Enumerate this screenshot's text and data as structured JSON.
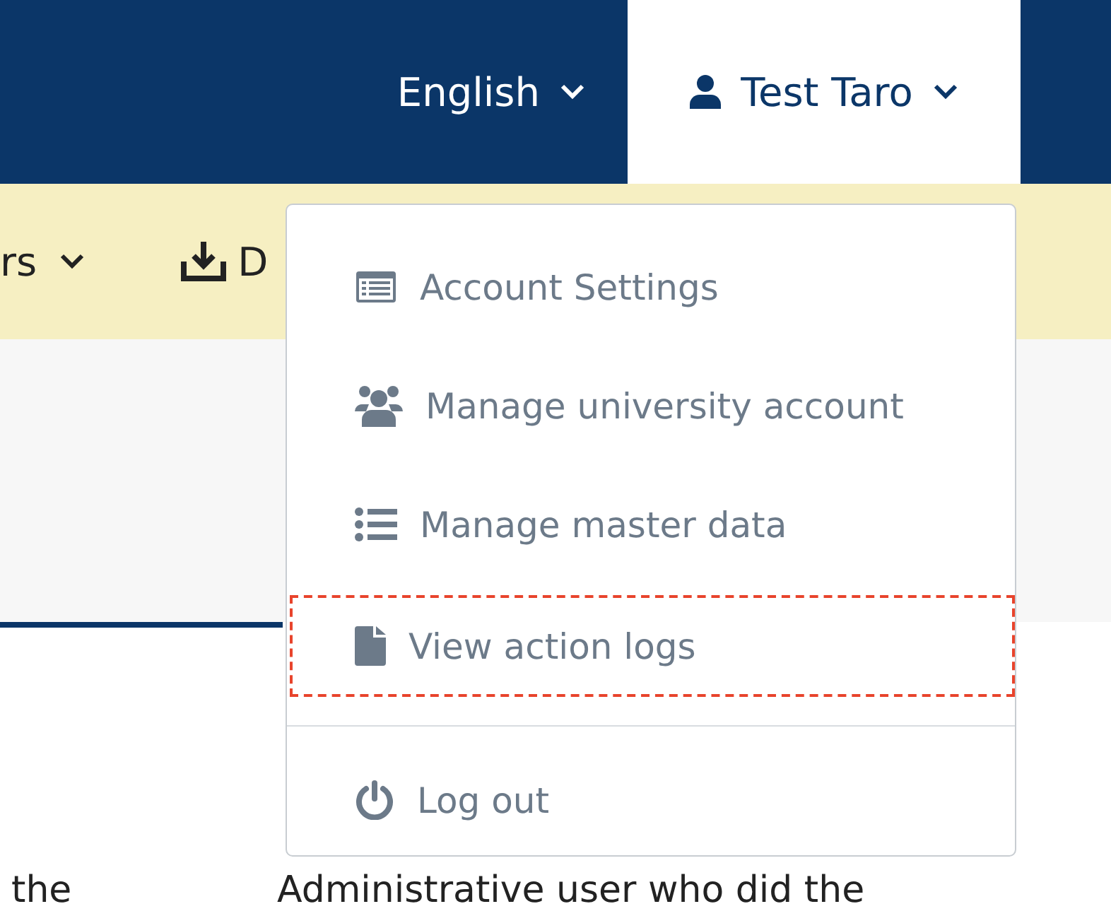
{
  "navbar": {
    "language": "English",
    "user": "Test Taro"
  },
  "toolbar": {
    "items": [
      {
        "label": "rs",
        "kind": "dropdown"
      },
      {
        "label": "D",
        "kind": "download"
      }
    ]
  },
  "content": {
    "texts": [
      "the",
      "Administrative user who did the"
    ]
  },
  "user_menu": {
    "items": [
      {
        "label": "Account Settings",
        "kind": "settings",
        "highlighted": false
      },
      {
        "label": "Manage university account",
        "kind": "users",
        "highlighted": false
      },
      {
        "label": "Manage master data",
        "kind": "list",
        "highlighted": false
      },
      {
        "label": "View action logs",
        "kind": "file",
        "highlighted": true
      },
      {
        "label": "Log out",
        "kind": "power",
        "highlighted": false
      }
    ]
  }
}
